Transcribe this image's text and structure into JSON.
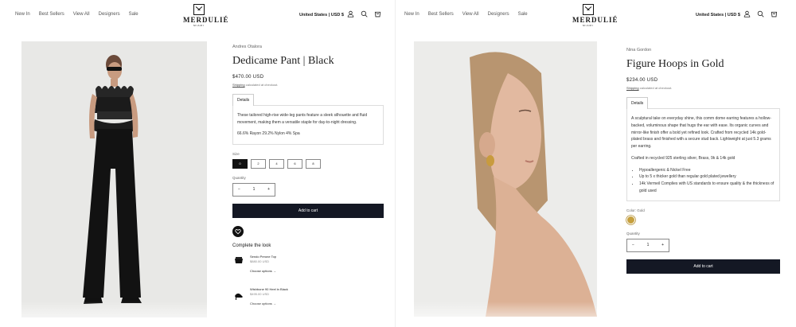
{
  "header": {
    "nav": [
      "New In",
      "Best Sellers",
      "View All",
      "Designers",
      "Sale"
    ],
    "logo_text": "MERDULIÉ",
    "logo_sub": "MIAMI",
    "country": "United States | USD $",
    "icons": [
      "account-icon",
      "search-icon",
      "cart-icon"
    ]
  },
  "left": {
    "vendor": "Andres Otalora",
    "title": "Dedicame Pant | Black",
    "price": "$470.00 USD",
    "shipping_link": "Shipping",
    "shipping_rest": "calculated at checkout.",
    "tab": "Details",
    "description": "These tailored high-rise wide-leg pants feature a sleek silhouette and fluid movement, making them a versatile staple for day-to-night dressing.",
    "composition": "66.6% Rayon 29.2% Nylon 4% Spa",
    "size_label": "Size",
    "sizes": [
      "0",
      "2",
      "4",
      "6",
      "8"
    ],
    "quantity_label": "Quantity",
    "quantity": "1",
    "add_to_cart": "Add to cart",
    "complete_look": "Complete the look",
    "recommendations": [
      {
        "name": "Sendo Perone Top",
        "price": "$880.00 USD",
        "cta": "Choose options"
      },
      {
        "name": "Wishbone 90 Heel in Black",
        "price": "$495.00 USD",
        "cta": "Choose options"
      }
    ]
  },
  "right": {
    "vendor": "Nina Gordon",
    "title": "Figure Hoops in Gold",
    "price": "$234.00 USD",
    "shipping_link": "Shipping",
    "shipping_rest": "calculated at checkout.",
    "tab": "Details",
    "description": "A sculptural take on everyday shine, this comm dome earring features a hollow-backed, voluminous shape that hugs the ear with ease. Its organic curves and mirror-like finish offer a bold yet refined look. Crafted from recycled 14k gold-plated brass and finished with a secure stud back. Lightweight at just 5.3 grams per earring.",
    "materials": "Crafted in recycled 925 sterling silver, Brass, 9k & 14k gold",
    "features": [
      "Hypoallergenic & Nickel Free",
      "Up to 5 x thicker gold than regular gold plated jewellery",
      "14k Vermeil Complies with US standards to ensure quality & the thickness of gold used"
    ],
    "color_label": "Color: Gold",
    "swatch_color": "#c6a03e",
    "quantity_label": "Quantity",
    "quantity": "1",
    "add_to_cart": "Add to cart"
  }
}
